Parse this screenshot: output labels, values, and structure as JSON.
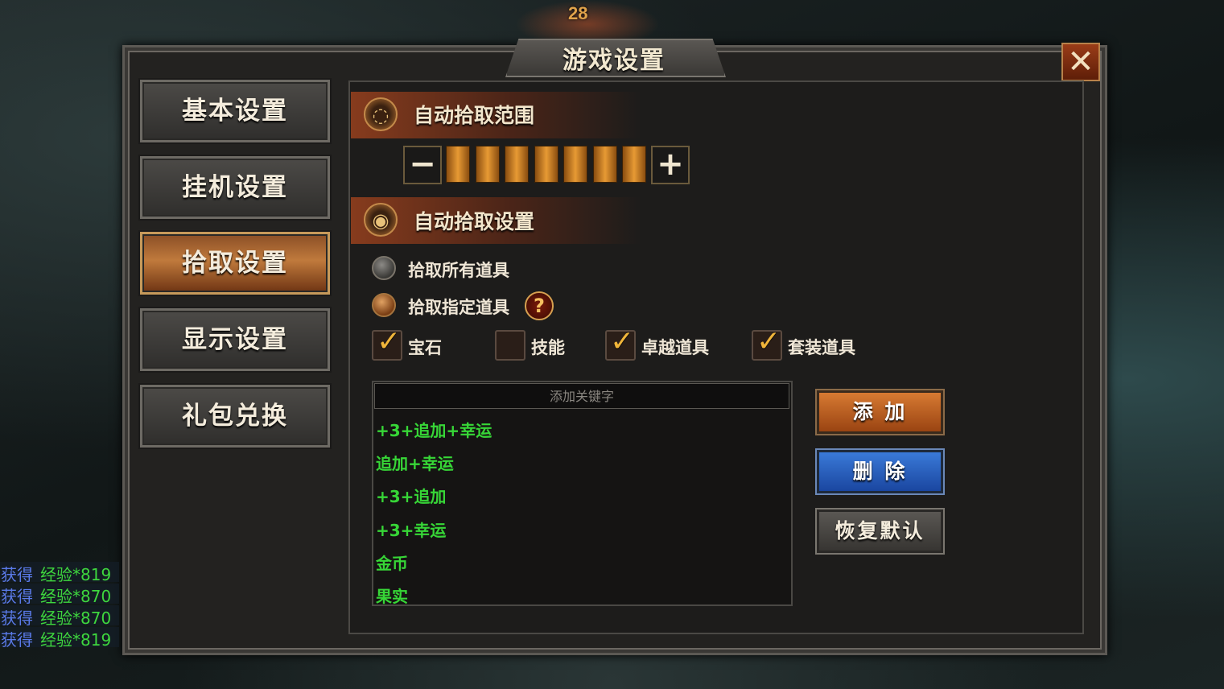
{
  "window": {
    "title": "游戏设置",
    "close_symbol": "✕"
  },
  "background": {
    "level_number": "28"
  },
  "menu": [
    {
      "label": "基本设置",
      "active": false
    },
    {
      "label": "挂机设置",
      "active": false
    },
    {
      "label": "拾取设置",
      "active": true
    },
    {
      "label": "显示设置",
      "active": false
    },
    {
      "label": "礼包兑换",
      "active": false
    }
  ],
  "pickup_range": {
    "title": "自动拾取范围",
    "minus": "−",
    "plus": "+",
    "level": 7,
    "max_level": 7
  },
  "pickup_settings": {
    "title": "自动拾取设置",
    "options": [
      {
        "label": "拾取所有道具",
        "selected": false
      },
      {
        "label": "拾取指定道具",
        "selected": true
      }
    ],
    "help": "?",
    "categories": [
      {
        "label": "宝石",
        "checked": true
      },
      {
        "label": "技能",
        "checked": false
      },
      {
        "label": "卓越道具",
        "checked": true
      },
      {
        "label": "套装道具",
        "checked": true
      }
    ]
  },
  "keywords": {
    "placeholder": "添加关键字",
    "items": [
      "+3+追加+幸运",
      "追加+幸运",
      "+3+追加",
      "+3+幸运",
      "金币",
      "果实"
    ]
  },
  "actions": {
    "add": "添 加",
    "delete": "删 除",
    "reset": "恢复默认"
  },
  "chat_log": [
    {
      "prefix": "获得",
      "text": "经验*819"
    },
    {
      "prefix": "获得",
      "text": "经验*870"
    },
    {
      "prefix": "获得",
      "text": "经验*870"
    },
    {
      "prefix": "获得",
      "text": "经验*819"
    }
  ],
  "colors": {
    "accent_orange": "#e79a34",
    "keyword_green": "#37d637",
    "delete_blue": "#2a5ec0"
  }
}
